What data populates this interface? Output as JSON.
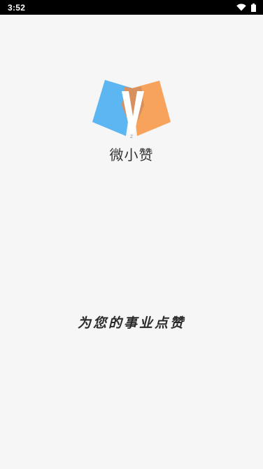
{
  "status_bar": {
    "time": "3:52",
    "icons": [
      "wifi-icon",
      "battery-icon"
    ]
  },
  "splash": {
    "app_name": "微小赞",
    "slogan": "为您的事业点赞",
    "logo_letter": "V",
    "logo_colors": {
      "left_panel": "#5cb6f2",
      "right_panel": "#f7a35b",
      "center_overlap": "#d9905f",
      "letter": "#ffffff"
    }
  }
}
